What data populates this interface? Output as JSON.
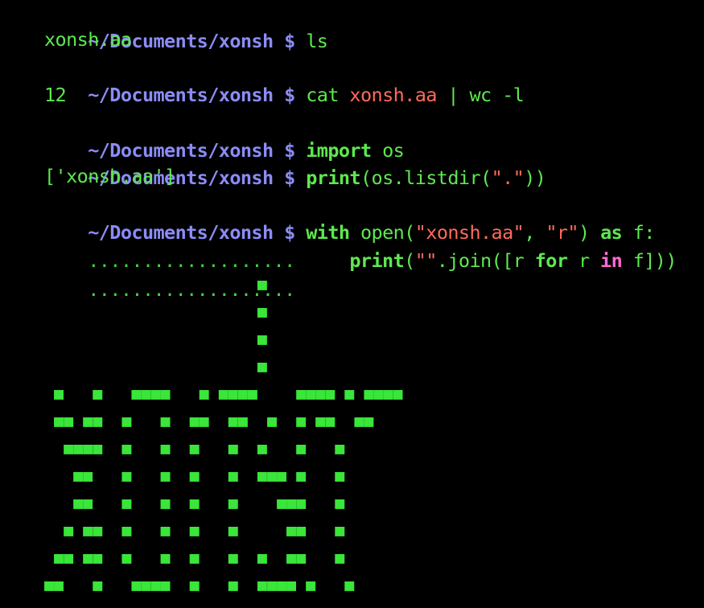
{
  "colors": {
    "background": "#000000",
    "prompt": "#8b8cf7",
    "output": "#5ee84f",
    "string": "#ff6b5b",
    "in_keyword": "#ff6ad5",
    "art": "#39e639"
  },
  "prompt_text": "~/Documents/xonsh",
  "dollar": "$",
  "lines": {
    "l1": {
      "cmd": "ls"
    },
    "l2": {
      "out": "xonsh.aa"
    },
    "l3": {
      "cmd_a": "cat ",
      "str": "xonsh.aa",
      "cmd_b": " | wc -l"
    },
    "l4": {
      "out": "12"
    },
    "l5": {
      "kw": "import",
      "rest": " os"
    },
    "l6": {
      "kw": "print",
      "a": "(os.listdir(",
      "str": "\".\"",
      "b": "))"
    },
    "l7": {
      "out": "['xonsh.aa']"
    },
    "l8": {
      "kw_with": "with",
      "a": " open(",
      "str1": "\"xonsh.aa\"",
      "comma": ", ",
      "str2": "\"r\"",
      "b": ") ",
      "kw_as": "as",
      "c": " f:"
    },
    "l9": {
      "dots": "...................",
      "pad": "     ",
      "kw_print": "print",
      "a": "(",
      "str": "\"\"",
      "b": ".join([r ",
      "kw_for": "for",
      "c": " r ",
      "kw_in": "in",
      "d": " f]))"
    },
    "l10": {
      "dots": "..................."
    }
  },
  "art_rows": [
    "                      ■",
    "                      ■",
    "                      ■",
    "                      ■",
    " ■   ■   ■■■■   ■ ■■■■    ■■■■ ■ ■■■■",
    " ■■ ■■  ■   ■  ■■  ■■  ■  ■ ■■  ■■",
    "  ■■■■  ■   ■  ■   ■  ■   ■   ■",
    "   ■■   ■   ■  ■   ■  ■■■ ■   ■",
    "   ■■   ■   ■  ■   ■    ■■■   ■",
    "  ■ ■■  ■   ■  ■   ■     ■■   ■",
    " ■■ ■■  ■   ■  ■   ■  ■  ■■   ■",
    "■■   ■   ■■■■  ■   ■  ■■■■ ■   ■"
  ]
}
